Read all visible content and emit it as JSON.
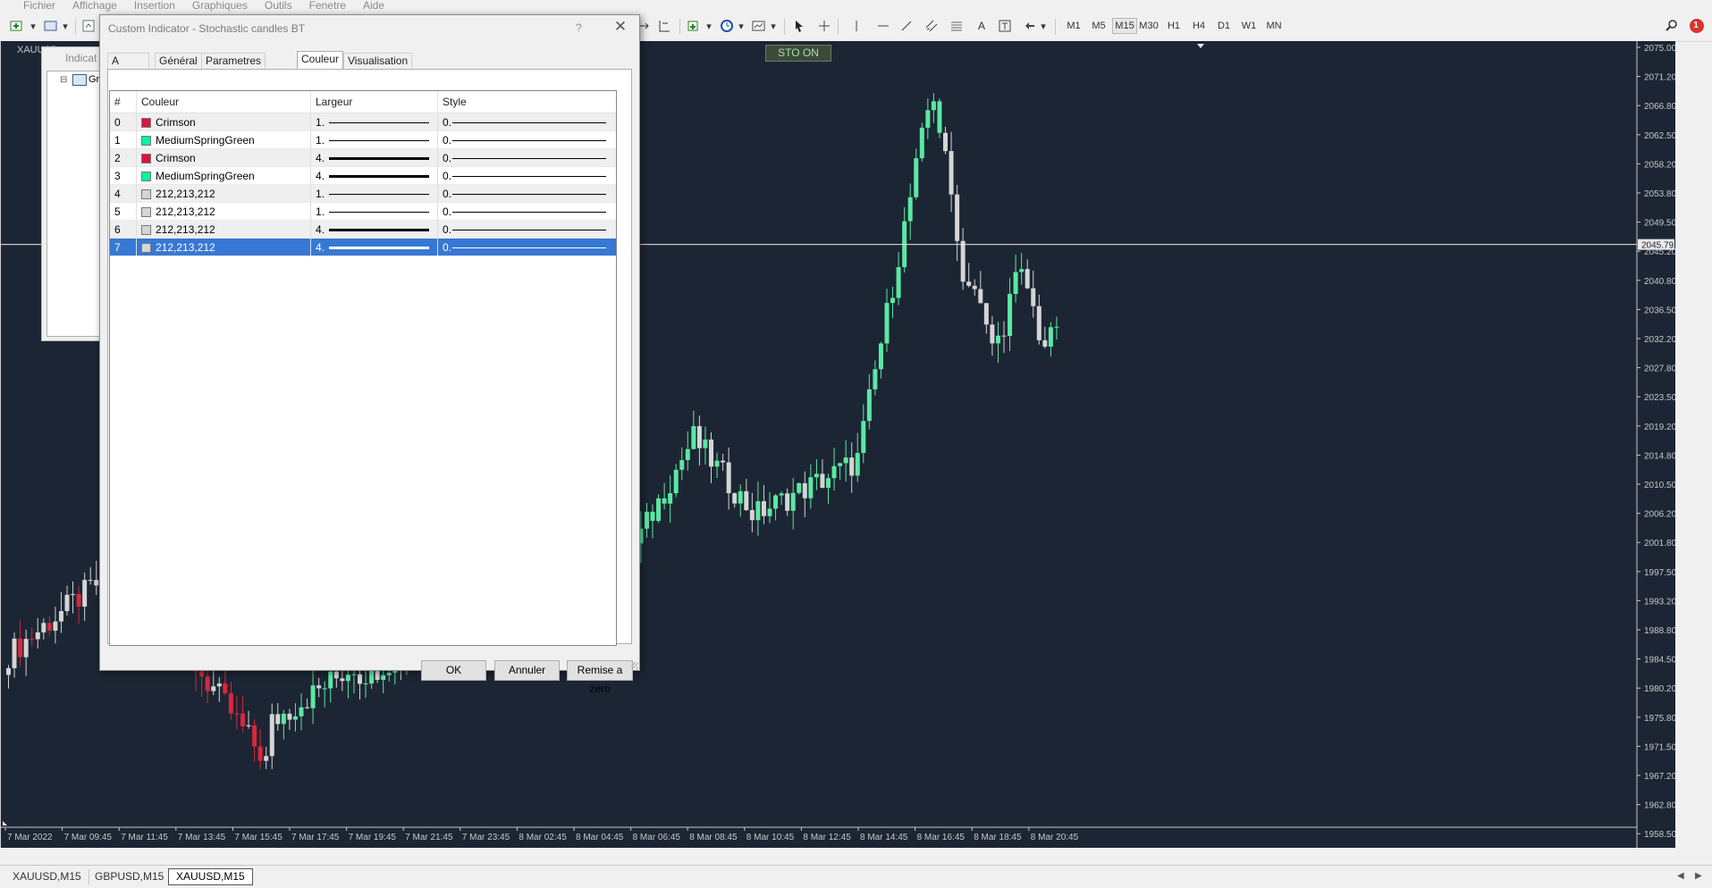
{
  "menu": [
    "Fichier",
    "Affichage",
    "Insertion",
    "Graphiques",
    "Outils",
    "Fenetre",
    "Aide"
  ],
  "timeframes": [
    "M1",
    "M5",
    "M15",
    "M30",
    "H1",
    "H4",
    "D1",
    "W1",
    "MN"
  ],
  "active_timeframe": "M15",
  "notification_count": "1",
  "chart": {
    "symbol_label": "XAUUSD",
    "sto_label": "STO ON",
    "crosshair_price": "2045.79",
    "price_labels": [
      "2075.00",
      "2071.20",
      "2066.80",
      "2062.50",
      "2058.20",
      "2053.80",
      "2049.50",
      "2045.20",
      "2040.80",
      "2036.50",
      "2032.20",
      "2027.80",
      "2023.50",
      "2019.20",
      "2014.80",
      "2010.50",
      "2006.20",
      "2001.80",
      "1997.50",
      "1993.20",
      "1988.80",
      "1984.50",
      "1980.20",
      "1975.80",
      "1971.50",
      "1967.20",
      "1962.80",
      "1958.50"
    ],
    "time_labels": [
      "7 Mar 2022",
      "7 Mar 09:45",
      "7 Mar 11:45",
      "7 Mar 13:45",
      "7 Mar 15:45",
      "7 Mar 17:45",
      "7 Mar 19:45",
      "7 Mar 21:45",
      "7 Mar 23:45",
      "8 Mar 02:45",
      "8 Mar 04:45",
      "8 Mar 06:45",
      "8 Mar 08:45",
      "8 Mar 10:45",
      "8 Mar 12:45",
      "8 Mar 14:45",
      "8 Mar 16:45",
      "8 Mar 18:45",
      "8 Mar 20:45"
    ],
    "colors": {
      "bg": "#1c2533",
      "bull": "#5be8a3",
      "bear": "#d5293f",
      "neutral": "#d4d5d4"
    }
  },
  "bottom_tabs": [
    "XAUUSD,M15",
    "GBPUSD,M15",
    "XAUUSD,M15"
  ],
  "active_bottom_tab": 2,
  "navigator": {
    "title": "Indicat",
    "item": "Gr"
  },
  "dialog": {
    "title": "Custom Indicator - Stochastic candles BT",
    "help": "?",
    "tabs": [
      "A propos",
      "Général",
      "Parametres d'entrée",
      "Couleur",
      "Visualisation"
    ],
    "active_tab": 3,
    "columns": [
      "#",
      "Couleur",
      "Largeur",
      "Style"
    ],
    "rows": [
      {
        "idx": "0",
        "color_name": "Crimson",
        "swatch": "#DC143C",
        "width": "1",
        "style": "0"
      },
      {
        "idx": "1",
        "color_name": "MediumSpringGreen",
        "swatch": "#00FA9A",
        "width": "1",
        "style": "0"
      },
      {
        "idx": "2",
        "color_name": "Crimson",
        "swatch": "#DC143C",
        "width": "4",
        "style": "0"
      },
      {
        "idx": "3",
        "color_name": "MediumSpringGreen",
        "swatch": "#00FA9A",
        "width": "4",
        "style": "0"
      },
      {
        "idx": "4",
        "color_name": "212,213,212",
        "swatch": "#D4D5D4",
        "width": "1",
        "style": "0"
      },
      {
        "idx": "5",
        "color_name": "212,213,212",
        "swatch": "#D4D5D4",
        "width": "1",
        "style": "0"
      },
      {
        "idx": "6",
        "color_name": "212,213,212",
        "swatch": "#D4D5D4",
        "width": "4",
        "style": "0"
      },
      {
        "idx": "7",
        "color_name": "212,213,212",
        "swatch": "#D4D5D4",
        "width": "4",
        "style": "0"
      }
    ],
    "selected_row": 7,
    "buttons": {
      "ok": "OK",
      "cancel": "Annuler",
      "reset": "Remise a zéro"
    }
  }
}
